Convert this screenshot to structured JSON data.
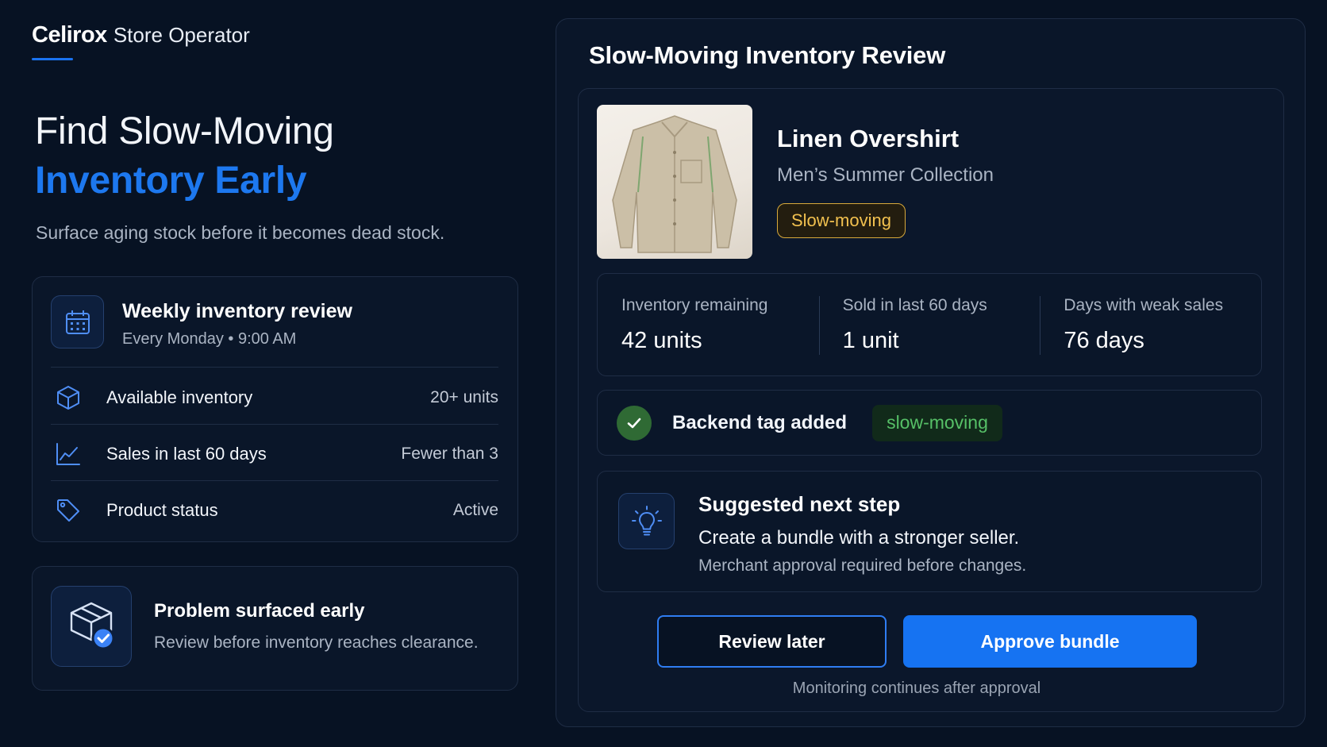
{
  "brand": {
    "name": "Celirox",
    "product": "Store Operator"
  },
  "hero": {
    "line1": "Find Slow-Moving",
    "line2": "Inventory Early",
    "description": "Surface aging stock before it becomes dead stock."
  },
  "review_rules": {
    "icon": "calendar-icon",
    "title": "Weekly inventory review",
    "schedule": "Every Monday  •  9:00 AM",
    "rows": [
      {
        "icon": "box-icon",
        "label": "Available inventory",
        "value": "20+ units"
      },
      {
        "icon": "chart-line-icon",
        "label": "Sales in last 60 days",
        "value": "Fewer than 3"
      },
      {
        "icon": "tag-icon",
        "label": "Product status",
        "value": "Active"
      }
    ]
  },
  "problem_card": {
    "icon": "package-check-icon",
    "title": "Problem surfaced early",
    "description": "Review before inventory reaches clearance."
  },
  "panel": {
    "title": "Slow-Moving Inventory Review",
    "product": {
      "name": "Linen Overshirt",
      "collection": "Men’s Summer Collection",
      "status": "Slow-moving"
    },
    "metrics": [
      {
        "label": "Inventory remaining",
        "value": "42 units"
      },
      {
        "label": "Sold in last 60 days",
        "value": "1 unit"
      },
      {
        "label": "Days with weak sales",
        "value": "76 days"
      }
    ],
    "tag": {
      "label": "Backend tag added",
      "value": "slow-moving"
    },
    "next_step": {
      "icon": "lightbulb-icon",
      "title": "Suggested next step",
      "action": "Create a bundle with a stronger seller.",
      "note": "Merchant approval required before changes."
    },
    "buttons": {
      "review_later": "Review later",
      "approve": "Approve bundle"
    },
    "footer_note": "Monitoring continues after approval"
  },
  "colors": {
    "background": "#071223",
    "accent": "#1673f2",
    "warning": "#f2c14f",
    "success": "#56c067"
  }
}
